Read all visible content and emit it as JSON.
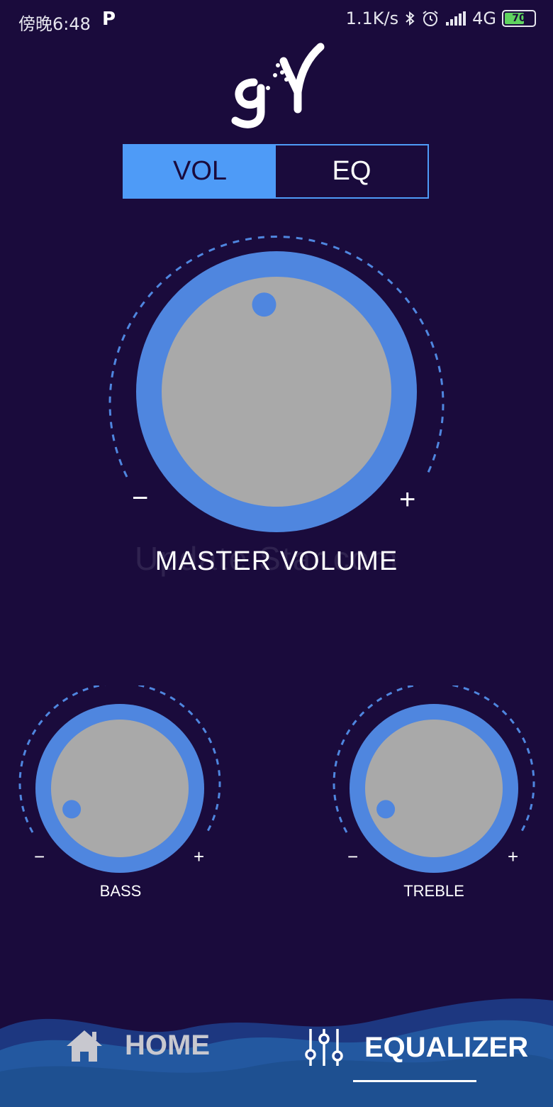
{
  "status_bar": {
    "time": "傍晚6:48",
    "p_badge": "P",
    "speed": "1.1K/s",
    "network": "4G",
    "battery": "70",
    "battery_level": 0.7
  },
  "logo": {
    "icon": "gy-logo"
  },
  "mode_toggle": {
    "vol_label": "VOL",
    "eq_label": "EQ",
    "selected": "VOL"
  },
  "master_volume": {
    "label": "MASTER VOLUME",
    "minus": "−",
    "plus": "+",
    "level": 0.47
  },
  "bass": {
    "label": "BASS",
    "minus": "−",
    "plus": "+",
    "level": 0.08
  },
  "treble": {
    "label": "TREBLE",
    "minus": "−",
    "plus": "+",
    "level": 0.08
  },
  "watermark": "Update Star.com",
  "bottom_nav": {
    "home_label": "HOME",
    "equalizer_label": "EQUALIZER",
    "selected": "EQUALIZER",
    "home_icon": "home-icon",
    "equalizer_icon": "sliders-icon"
  },
  "colors": {
    "background": "#1a0b3c",
    "accent": "#4e9bf7",
    "ring": "#4f86df",
    "knob": "#a9a9a9"
  }
}
